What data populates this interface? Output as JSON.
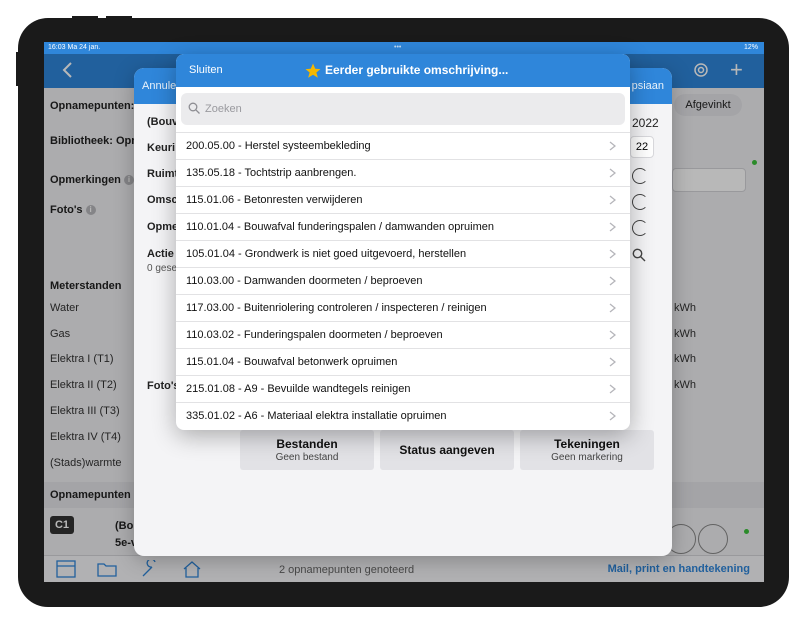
{
  "statusbar": {
    "time": "16:03",
    "date": "Ma 24 jan.",
    "center": "•••",
    "battery": "12%"
  },
  "background": {
    "opnamepunten_label": "Opnamepunten:",
    "bibliotheek_label": "Bibliotheek: Opn",
    "opmerkingen_label": "Opmerkingen",
    "fotos_label": "Foto's",
    "meterstanden_label": "Meterstanden",
    "meters": [
      "Water",
      "Gas",
      "Elektra I (T1)",
      "Elektra II (T2)",
      "Elektra III (T3)",
      "Elektra IV (T4)",
      "(Stads)warmte"
    ],
    "meter_units": [
      "kWh",
      "kWh",
      "kWh",
      "kWh"
    ],
    "afgevinkt_label": "Afgevinkt",
    "opnamepunten_section": "Opnamepunten",
    "item_badge": "C1",
    "item_title": "(Bou",
    "item_sub": "5e-v"
  },
  "sheet": {
    "cancel": "Annule",
    "save": "psiaan",
    "bouw": "(Bouv",
    "keuring": "Keuri",
    "ruimte": "Ruimt",
    "omschrijving": "Omsc",
    "opmerking": "Opme",
    "actie": "Actie",
    "actie_sub": "0 gese",
    "year": "2022",
    "field_val": "22",
    "fotos": "Foto's"
  },
  "actions": {
    "bestanden": {
      "title": "Bestanden",
      "sub": "Geen bestand"
    },
    "status": {
      "title": "Status aangeven"
    },
    "tekeningen": {
      "title": "Tekeningen",
      "sub": "Geen markering"
    }
  },
  "tabbar": {
    "status": "2 opnamepunten genoteerd",
    "mail": "Mail, print en handtekening"
  },
  "popover": {
    "close": "Sluiten",
    "title": "Eerder gebruikte omschrijving...",
    "search_placeholder": "Zoeken",
    "items": [
      "200.05.00 - Herstel systeembekleding",
      "135.05.18 - Tochtstrip aanbrengen.",
      "115.01.06 - Betonresten verwijderen",
      "110.01.04 - Bouwafval funderingspalen / damwanden opruimen",
      "105.01.04 - Grondwerk is niet goed uitgevoerd, herstellen",
      "110.03.00 - Damwanden doormeten / beproeven",
      "117.03.00 - Buitenriolering controleren / inspecteren / reinigen",
      "110.03.02 - Funderingspalen doormeten / beproeven",
      "115.01.04 - Bouwafval betonwerk opruimen",
      "215.01.08 - A9 - Bevuilde wandtegels reinigen",
      "335.01.02 - A6 - Materiaal elektra installatie opruimen"
    ]
  },
  "colors": {
    "accent": "#2f86da",
    "star": "#f5b800",
    "online": "#3cc13b"
  }
}
